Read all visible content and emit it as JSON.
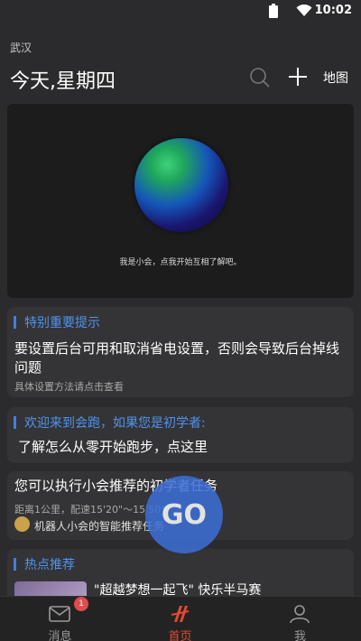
{
  "status": {
    "time": "10:02"
  },
  "header": {
    "city": "武汉",
    "title": "今天,星期四",
    "map_label": "地图"
  },
  "hero": {
    "caption": "我是小会，点我开始互相了解吧。"
  },
  "cards": {
    "notice": {
      "title": "特别重要提示",
      "body": "要设置后台可用和取消省电设置，否则会导致后台掉线问题",
      "sub": "具体设置方法请点击查看"
    },
    "welcome": {
      "title": "欢迎来到会跑，如果您是初学者:",
      "body": "了解怎么从零开始跑步，点这里"
    },
    "task": {
      "title": "您可以执行小会推荐的初学者任务",
      "detail": "距离1公里，配速15'20\"～15'50\"",
      "recommender": "机器人小会的智能推荐任务"
    },
    "hot": {
      "title": "热点推荐",
      "item_title": "\"超越梦想一起飞\" 快乐半马赛"
    }
  },
  "go_button": {
    "label": "GO"
  },
  "tabbar": {
    "items": [
      {
        "label": "消息",
        "badge": "1"
      },
      {
        "label": "首页"
      },
      {
        "label": "我"
      }
    ]
  },
  "colors": {
    "accent": "#4f93f0",
    "active_tab": "#e24a32",
    "badge": "#e04b4b"
  }
}
